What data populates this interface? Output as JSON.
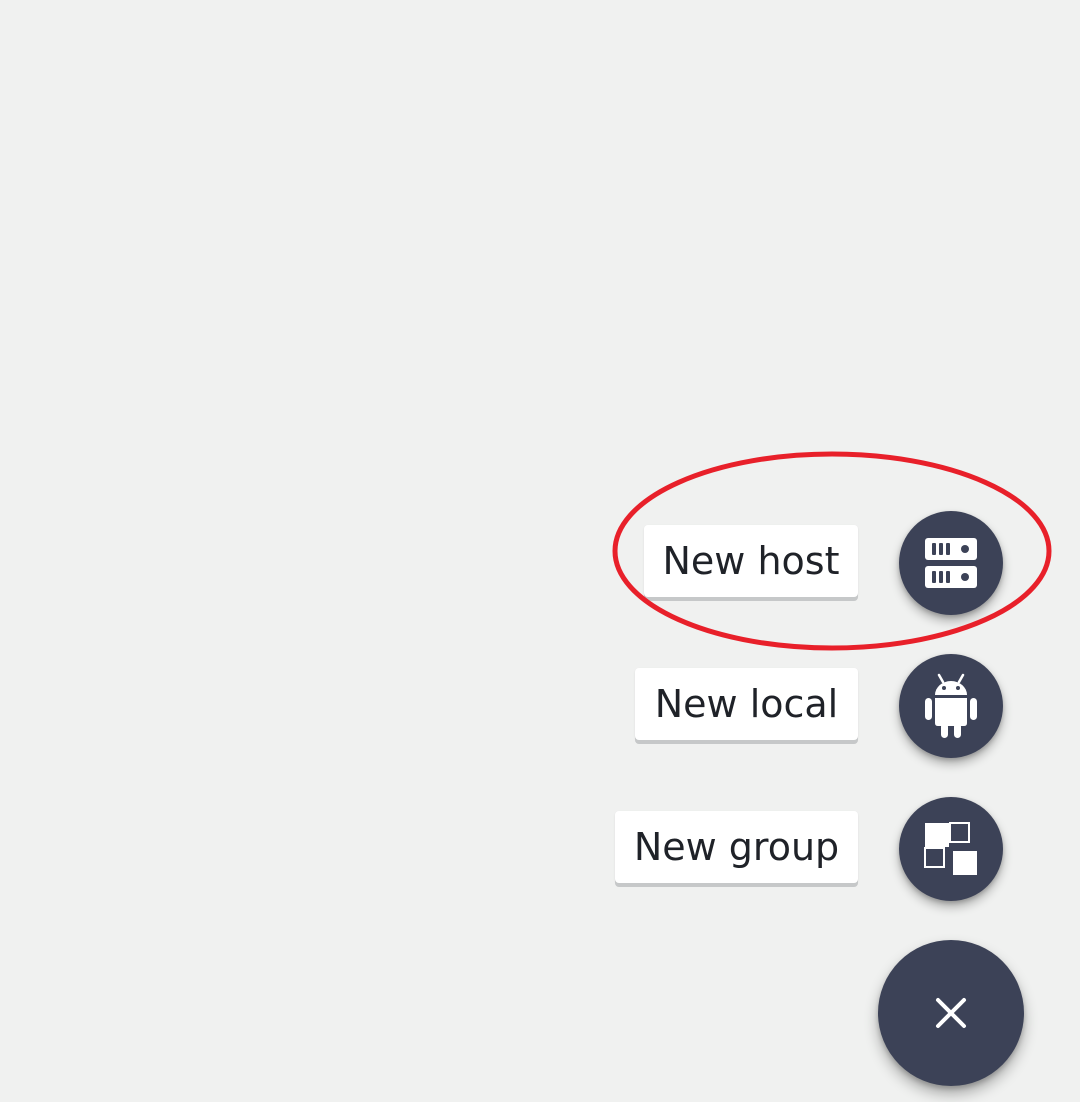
{
  "speed_dial": {
    "actions": [
      {
        "label": "New host",
        "icon": "server-icon"
      },
      {
        "label": "New local",
        "icon": "android-icon"
      },
      {
        "label": "New group",
        "icon": "group-squares-icon"
      }
    ],
    "main_button_icon": "close-icon"
  },
  "colors": {
    "background": "#f0f1f0",
    "fab": "#3c4257",
    "label_background": "#ffffff",
    "label_text": "#1f2228",
    "annotation": "#e8202a"
  }
}
